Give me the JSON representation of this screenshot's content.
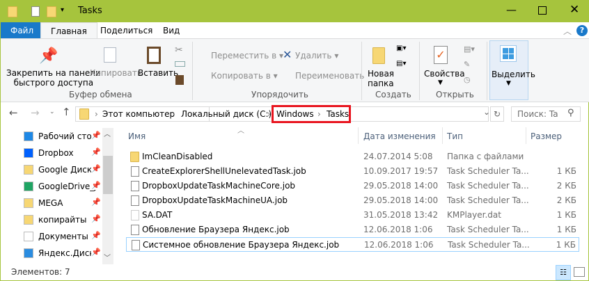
{
  "window": {
    "title": "Tasks",
    "title_color": "#a6c43d"
  },
  "tabs": {
    "file": "Файл",
    "home": "Главная",
    "share": "Поделиться",
    "view": "Вид"
  },
  "ribbon": {
    "pin": "Закрепить на панели\nбыстрого доступа",
    "pin_l1": "Закрепить на панели",
    "pin_l2": "быстрого доступа",
    "copy": "Копировать",
    "paste": "Вставить",
    "clipboard_group": "Буфер обмена",
    "move_to": "Переместить в",
    "copy_to": "Копировать в",
    "delete": "Удалить",
    "rename": "Переименовать",
    "organize_group": "Упорядочить",
    "new_folder_l1": "Новая",
    "new_folder_l2": "папка",
    "create_group": "Создать",
    "properties": "Свойства",
    "open_group": "Открыть",
    "select": "Выделить"
  },
  "address": {
    "crumbs": [
      "Этот компьютер",
      "Локальный диск (C:)",
      "Windows",
      "Tasks"
    ],
    "search_placeholder": "Поиск: Ta"
  },
  "nav": [
    "Рабочий стол",
    "Dropbox",
    "Google Диск",
    "GoogleDrive_j",
    "MEGA",
    "копирайты",
    "Документы",
    "Яндекс.Диск"
  ],
  "columns": {
    "name": "Имя",
    "date": "Дата изменения",
    "type": "Тип",
    "size": "Размер"
  },
  "files": [
    {
      "name": "ImCleanDisabled",
      "date": "24.07.2014 5:08",
      "type": "Папка с файлами",
      "size": ""
    },
    {
      "name": "CreateExplorerShellUnelevatedTask.job",
      "date": "10.09.2017 19:57",
      "type": "Task Scheduler Ta...",
      "size": "1 КБ"
    },
    {
      "name": "DropboxUpdateTaskMachineCore.job",
      "date": "29.05.2018 14:00",
      "type": "Task Scheduler Ta...",
      "size": "2 КБ"
    },
    {
      "name": "DropboxUpdateTaskMachineUA.job",
      "date": "29.05.2018 14:00",
      "type": "Task Scheduler Ta...",
      "size": "2 КБ"
    },
    {
      "name": "SA.DAT",
      "date": "31.05.2018 13:42",
      "type": "KMPlayer.dat",
      "size": "1 КБ"
    },
    {
      "name": "Обновление Браузера Яндекс.job",
      "date": "12.06.2018 1:06",
      "type": "Task Scheduler Ta...",
      "size": "1 КБ"
    },
    {
      "name": "Системное обновление Браузера Яндекс.job",
      "date": "12.06.2018 1:06",
      "type": "Task Scheduler Ta...",
      "size": "1 КБ"
    }
  ],
  "status": {
    "count": "Элементов: 7"
  }
}
